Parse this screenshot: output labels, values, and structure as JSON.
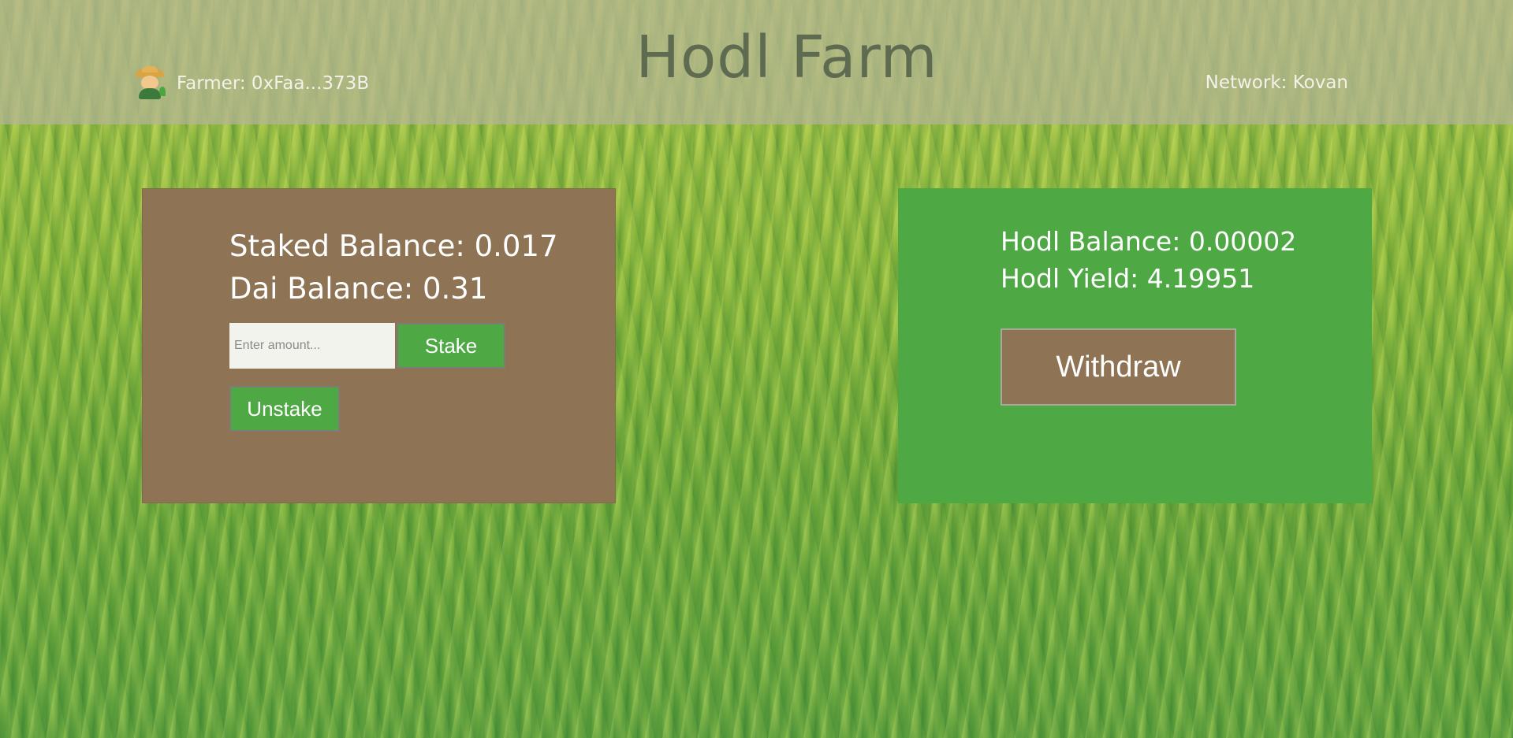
{
  "header": {
    "title": "Hodl Farm",
    "farmer_label": "Farmer: 0xFaa...373B",
    "network_label": "Network: Kovan"
  },
  "stake_card": {
    "staked_balance": "Staked Balance: 0.017",
    "dai_balance": "Dai Balance: 0.31",
    "amount_placeholder": "Enter amount...",
    "stake_label": "Stake",
    "unstake_label": "Unstake"
  },
  "yield_card": {
    "hodl_balance": "Hodl Balance: 0.00002",
    "hodl_yield": "Hodl Yield: 4.19951",
    "withdraw_label": "Withdraw"
  },
  "colors": {
    "stake_card_bg": "#8e7455",
    "yield_card_bg": "#4ea945",
    "header_bg": "#b4b496",
    "button_green": "#4ea945"
  },
  "icons": {
    "farmer": "farmer-icon"
  }
}
